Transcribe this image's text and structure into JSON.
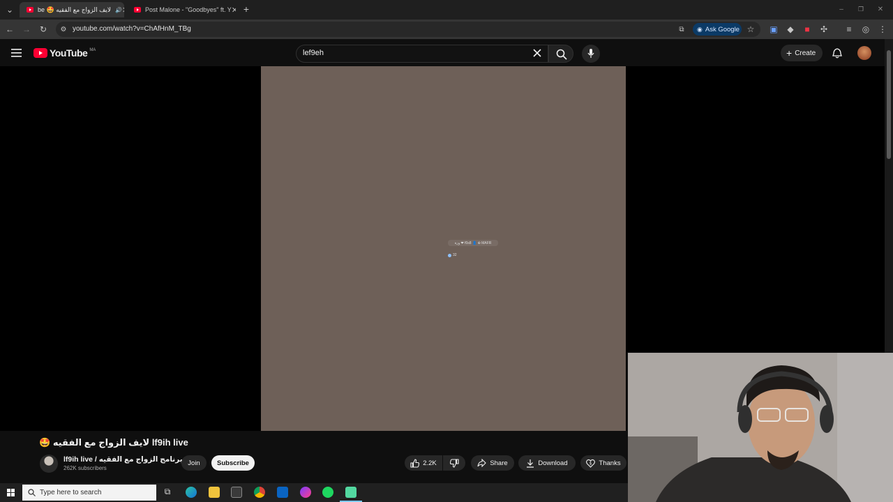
{
  "browser": {
    "tabs": [
      {
        "label": "be 🤩 لايف الزواج مع الفقيه",
        "active": true
      },
      {
        "label": "Post Malone - \"Goodbyes\" ft. Y",
        "active": false
      }
    ],
    "url": "youtube.com/watch?v=ChAfHnM_TBg",
    "ask_google_label": "Ask Google"
  },
  "youtube": {
    "logo_text": "YouTube",
    "region": "MA",
    "search_query": "lef9eh",
    "create_label": "Create"
  },
  "video": {
    "overlay_text": "وزة ❤ f0s8 👤 ⊕ MAFR",
    "viewer_count": "32",
    "title": "🤩 لايف الزواج مع الفقيه  lf9ih live",
    "channel_name": "lf9ih live / برنامج الزواج مع الفقيه",
    "subscribers": "262K subscribers",
    "join_label": "Join",
    "subscribe_label": "Subscribe",
    "likes": "2.2K",
    "share_label": "Share",
    "download_label": "Download",
    "thanks_label": "Thanks"
  },
  "taskbar": {
    "search_placeholder": "Type here to search"
  },
  "colors": {
    "yt_red": "#ff0033",
    "video_bg": "#6e6058",
    "page_bg": "#0f0f0f"
  }
}
